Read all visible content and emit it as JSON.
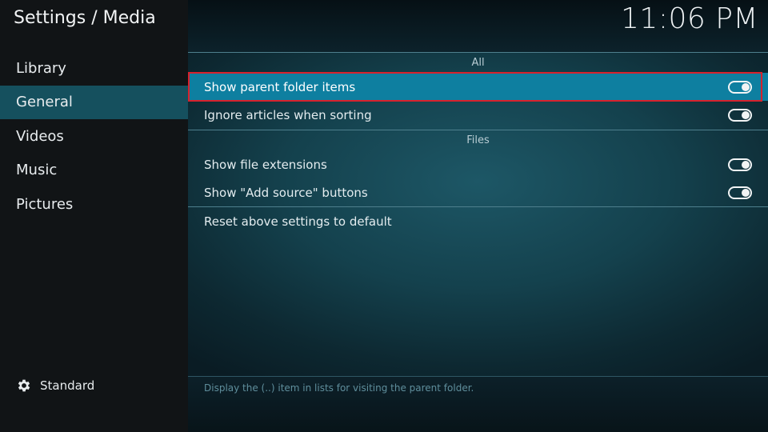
{
  "window": {
    "title": "Settings / Media",
    "clock": "11:06 PM"
  },
  "sidebar": {
    "items": [
      {
        "label": "Library"
      },
      {
        "label": "General",
        "active": true
      },
      {
        "label": "Videos"
      },
      {
        "label": "Music"
      },
      {
        "label": "Pictures"
      }
    ],
    "level": {
      "label": "Standard",
      "icon": "gear-icon"
    }
  },
  "main": {
    "sections": [
      {
        "label": "All",
        "settings": [
          {
            "label": "Show parent folder items",
            "toggle": true,
            "focused": true
          },
          {
            "label": "Ignore articles when sorting",
            "toggle": true
          }
        ]
      },
      {
        "label": "Files",
        "settings": [
          {
            "label": "Show file extensions",
            "toggle": true
          },
          {
            "label": "Show \"Add source\" buttons",
            "toggle": true
          }
        ]
      }
    ],
    "reset_label": "Reset above settings to default",
    "help_text": "Display the (..) item in lists for visiting the parent folder."
  },
  "colors": {
    "focus_bg": "#0e7fa0",
    "focus_outline": "#d8222d",
    "sidebar_active": "#15505e"
  }
}
